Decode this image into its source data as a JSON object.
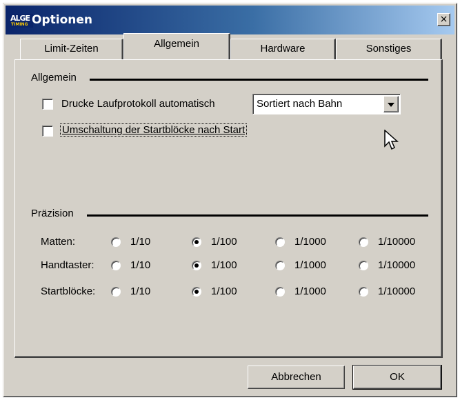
{
  "window": {
    "title": "Optionen",
    "logo_top": "ALGE",
    "logo_bottom": "TIMING",
    "close_glyph": "×"
  },
  "tabs": [
    {
      "label": "Limit-Zeiten",
      "active": false
    },
    {
      "label": "Allgemein",
      "active": true
    },
    {
      "label": "Hardware",
      "active": false
    },
    {
      "label": "Sonstiges",
      "active": false
    }
  ],
  "general": {
    "group_label": "Allgemein",
    "print_log_label": "Drucke Laufprotokoll automatisch",
    "print_log_checked": false,
    "sort_select_value": "Sortiert nach Bahn",
    "switch_blocks_label": "Umschaltung der Startblöcke nach Start",
    "switch_blocks_checked": false
  },
  "precision": {
    "group_label": "Präzision",
    "options": [
      "1/10",
      "1/100",
      "1/1000",
      "1/10000"
    ],
    "rows": [
      {
        "label": "Matten:",
        "selected": "1/100"
      },
      {
        "label": "Handtaster:",
        "selected": "1/100"
      },
      {
        "label": "Startblöcke:",
        "selected": "1/100"
      }
    ]
  },
  "buttons": {
    "cancel": "Abbrechen",
    "ok": "OK"
  },
  "icons": {
    "close": "close-icon",
    "dropdown": "chevron-down-icon",
    "cursor": "mouse-pointer-icon"
  },
  "colors": {
    "titlebar_start": "#0a246a",
    "titlebar_end": "#a6caf0",
    "face": "#d4d0c8"
  }
}
